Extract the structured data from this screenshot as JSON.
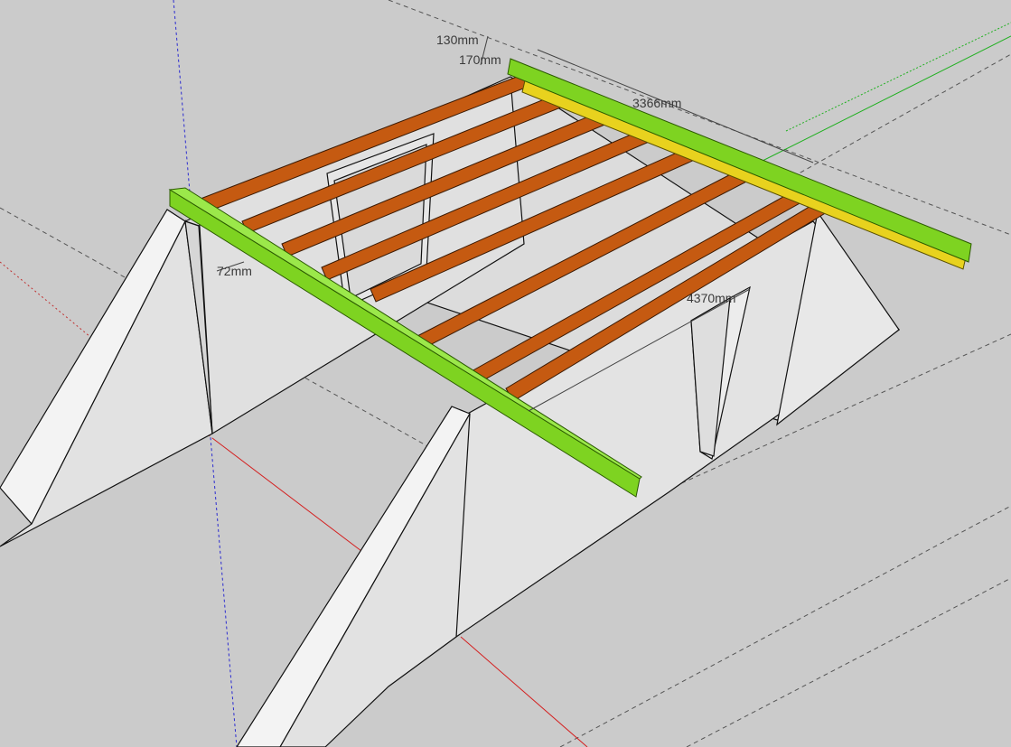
{
  "viewport": {
    "background_color": "#cbcbcb",
    "colors": {
      "wall_face": "#e2e2e2",
      "wall_edge": "#111111",
      "rafter": "#c55a11",
      "rafter_shade": "#8a3d07",
      "green_beam": "#7ed321",
      "yellow_beam": "#e8d21e",
      "axis_red": "#d42020",
      "axis_green": "#20b020",
      "axis_blue": "#2020d0",
      "guide_line": "#555555"
    }
  },
  "dimensions": {
    "d130": "130mm",
    "d170": "170mm",
    "d3366": "3366mm",
    "d72": "72mm",
    "d4370": "4370mm"
  }
}
